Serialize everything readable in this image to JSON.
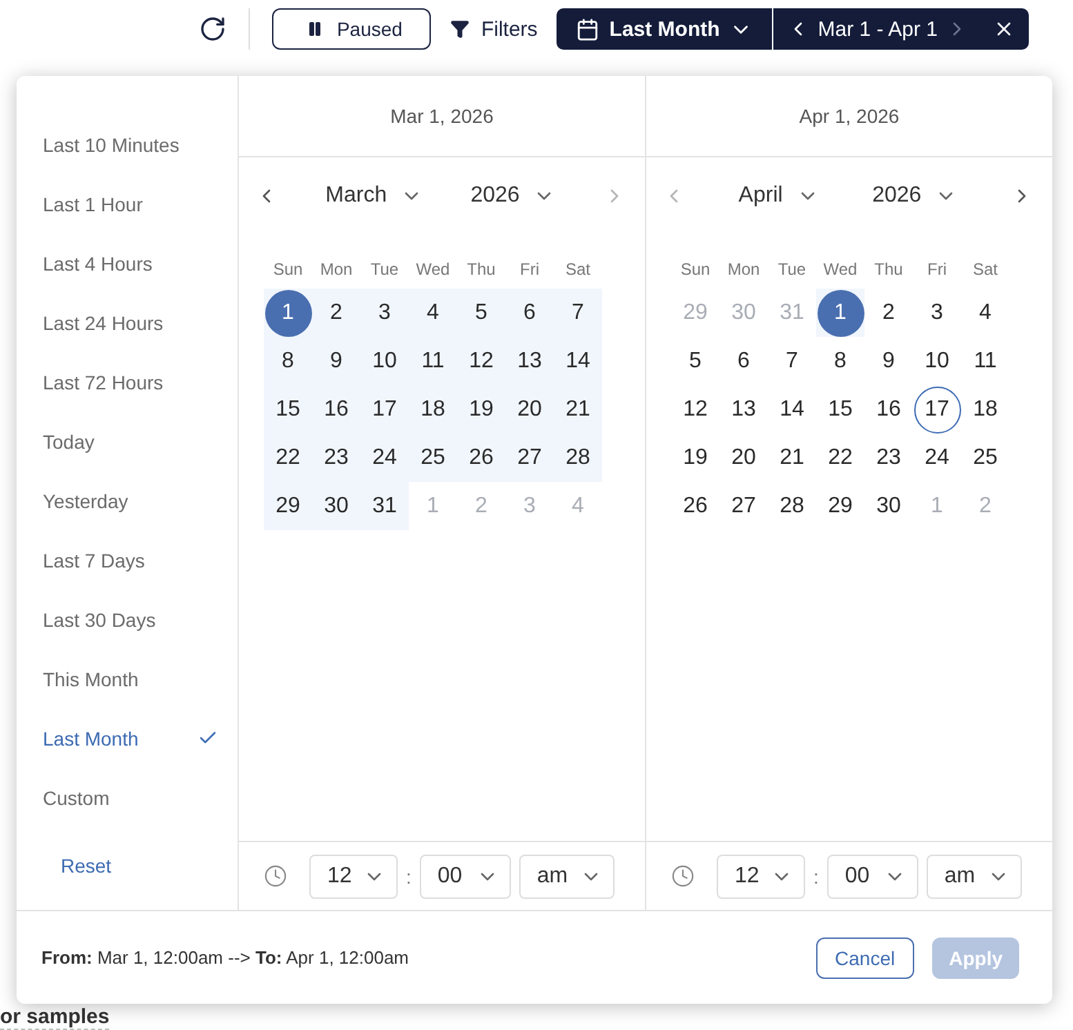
{
  "toolbar": {
    "pause_button": {
      "label": "Paused"
    },
    "filters_button": {
      "label": "Filters"
    },
    "range_button": {
      "label": "Last Month"
    },
    "range_nav": {
      "label": "Mar 1 - Apr 1",
      "prev_enabled": true,
      "next_enabled": false
    }
  },
  "background": {
    "heading": "or samples"
  },
  "presets": [
    {
      "label": "Last 10 Minutes",
      "selected": false
    },
    {
      "label": "Last 1 Hour",
      "selected": false
    },
    {
      "label": "Last 4 Hours",
      "selected": false
    },
    {
      "label": "Last 24 Hours",
      "selected": false
    },
    {
      "label": "Last 72 Hours",
      "selected": false
    },
    {
      "label": "Today",
      "selected": false
    },
    {
      "label": "Yesterday",
      "selected": false
    },
    {
      "label": "Last 7 Days",
      "selected": false
    },
    {
      "label": "Last 30 Days",
      "selected": false
    },
    {
      "label": "This Month",
      "selected": false
    },
    {
      "label": "Last Month",
      "selected": true
    },
    {
      "label": "Custom",
      "selected": false
    }
  ],
  "reset": "Reset",
  "calendars": [
    {
      "date_label": "Mar 1, 2026",
      "month": "March",
      "year": "2026",
      "prev_enabled": true,
      "next_enabled": false,
      "weekdays": [
        "Sun",
        "Mon",
        "Tue",
        "Wed",
        "Thu",
        "Fri",
        "Sat"
      ],
      "days": [
        {
          "label": "1",
          "outside": false,
          "in_range": true,
          "selected": true,
          "today": false
        },
        {
          "label": "2",
          "outside": false,
          "in_range": true,
          "selected": false,
          "today": false
        },
        {
          "label": "3",
          "outside": false,
          "in_range": true,
          "selected": false,
          "today": false
        },
        {
          "label": "4",
          "outside": false,
          "in_range": true,
          "selected": false,
          "today": false
        },
        {
          "label": "5",
          "outside": false,
          "in_range": true,
          "selected": false,
          "today": false
        },
        {
          "label": "6",
          "outside": false,
          "in_range": true,
          "selected": false,
          "today": false
        },
        {
          "label": "7",
          "outside": false,
          "in_range": true,
          "selected": false,
          "today": false
        },
        {
          "label": "8",
          "outside": false,
          "in_range": true,
          "selected": false,
          "today": false
        },
        {
          "label": "9",
          "outside": false,
          "in_range": true,
          "selected": false,
          "today": false
        },
        {
          "label": "10",
          "outside": false,
          "in_range": true,
          "selected": false,
          "today": false
        },
        {
          "label": "11",
          "outside": false,
          "in_range": true,
          "selected": false,
          "today": false
        },
        {
          "label": "12",
          "outside": false,
          "in_range": true,
          "selected": false,
          "today": false
        },
        {
          "label": "13",
          "outside": false,
          "in_range": true,
          "selected": false,
          "today": false
        },
        {
          "label": "14",
          "outside": false,
          "in_range": true,
          "selected": false,
          "today": false
        },
        {
          "label": "15",
          "outside": false,
          "in_range": true,
          "selected": false,
          "today": false
        },
        {
          "label": "16",
          "outside": false,
          "in_range": true,
          "selected": false,
          "today": false
        },
        {
          "label": "17",
          "outside": false,
          "in_range": true,
          "selected": false,
          "today": false
        },
        {
          "label": "18",
          "outside": false,
          "in_range": true,
          "selected": false,
          "today": false
        },
        {
          "label": "19",
          "outside": false,
          "in_range": true,
          "selected": false,
          "today": false
        },
        {
          "label": "20",
          "outside": false,
          "in_range": true,
          "selected": false,
          "today": false
        },
        {
          "label": "21",
          "outside": false,
          "in_range": true,
          "selected": false,
          "today": false
        },
        {
          "label": "22",
          "outside": false,
          "in_range": true,
          "selected": false,
          "today": false
        },
        {
          "label": "23",
          "outside": false,
          "in_range": true,
          "selected": false,
          "today": false
        },
        {
          "label": "24",
          "outside": false,
          "in_range": true,
          "selected": false,
          "today": false
        },
        {
          "label": "25",
          "outside": false,
          "in_range": true,
          "selected": false,
          "today": false
        },
        {
          "label": "26",
          "outside": false,
          "in_range": true,
          "selected": false,
          "today": false
        },
        {
          "label": "27",
          "outside": false,
          "in_range": true,
          "selected": false,
          "today": false
        },
        {
          "label": "28",
          "outside": false,
          "in_range": true,
          "selected": false,
          "today": false
        },
        {
          "label": "29",
          "outside": false,
          "in_range": true,
          "selected": false,
          "today": false
        },
        {
          "label": "30",
          "outside": false,
          "in_range": true,
          "selected": false,
          "today": false
        },
        {
          "label": "31",
          "outside": false,
          "in_range": true,
          "selected": false,
          "today": false
        },
        {
          "label": "1",
          "outside": true,
          "in_range": false,
          "selected": false,
          "today": false
        },
        {
          "label": "2",
          "outside": true,
          "in_range": false,
          "selected": false,
          "today": false
        },
        {
          "label": "3",
          "outside": true,
          "in_range": false,
          "selected": false,
          "today": false
        },
        {
          "label": "4",
          "outside": true,
          "in_range": false,
          "selected": false,
          "today": false
        }
      ],
      "time": {
        "hour": "12",
        "separator": ":",
        "minute": "00",
        "period": "am"
      }
    },
    {
      "date_label": "Apr 1, 2026",
      "month": "April",
      "year": "2026",
      "prev_enabled": false,
      "next_enabled": true,
      "weekdays": [
        "Sun",
        "Mon",
        "Tue",
        "Wed",
        "Thu",
        "Fri",
        "Sat"
      ],
      "days": [
        {
          "label": "29",
          "outside": true,
          "in_range": false,
          "selected": false,
          "today": false
        },
        {
          "label": "30",
          "outside": true,
          "in_range": false,
          "selected": false,
          "today": false
        },
        {
          "label": "31",
          "outside": true,
          "in_range": false,
          "selected": false,
          "today": false
        },
        {
          "label": "1",
          "outside": false,
          "in_range": true,
          "selected": true,
          "today": false
        },
        {
          "label": "2",
          "outside": false,
          "in_range": false,
          "selected": false,
          "today": false
        },
        {
          "label": "3",
          "outside": false,
          "in_range": false,
          "selected": false,
          "today": false
        },
        {
          "label": "4",
          "outside": false,
          "in_range": false,
          "selected": false,
          "today": false
        },
        {
          "label": "5",
          "outside": false,
          "in_range": false,
          "selected": false,
          "today": false
        },
        {
          "label": "6",
          "outside": false,
          "in_range": false,
          "selected": false,
          "today": false
        },
        {
          "label": "7",
          "outside": false,
          "in_range": false,
          "selected": false,
          "today": false
        },
        {
          "label": "8",
          "outside": false,
          "in_range": false,
          "selected": false,
          "today": false
        },
        {
          "label": "9",
          "outside": false,
          "in_range": false,
          "selected": false,
          "today": false
        },
        {
          "label": "10",
          "outside": false,
          "in_range": false,
          "selected": false,
          "today": false
        },
        {
          "label": "11",
          "outside": false,
          "in_range": false,
          "selected": false,
          "today": false
        },
        {
          "label": "12",
          "outside": false,
          "in_range": false,
          "selected": false,
          "today": false
        },
        {
          "label": "13",
          "outside": false,
          "in_range": false,
          "selected": false,
          "today": false
        },
        {
          "label": "14",
          "outside": false,
          "in_range": false,
          "selected": false,
          "today": false
        },
        {
          "label": "15",
          "outside": false,
          "in_range": false,
          "selected": false,
          "today": false
        },
        {
          "label": "16",
          "outside": false,
          "in_range": false,
          "selected": false,
          "today": false
        },
        {
          "label": "17",
          "outside": false,
          "in_range": false,
          "selected": false,
          "today": true
        },
        {
          "label": "18",
          "outside": false,
          "in_range": false,
          "selected": false,
          "today": false
        },
        {
          "label": "19",
          "outside": false,
          "in_range": false,
          "selected": false,
          "today": false
        },
        {
          "label": "20",
          "outside": false,
          "in_range": false,
          "selected": false,
          "today": false
        },
        {
          "label": "21",
          "outside": false,
          "in_range": false,
          "selected": false,
          "today": false
        },
        {
          "label": "22",
          "outside": false,
          "in_range": false,
          "selected": false,
          "today": false
        },
        {
          "label": "23",
          "outside": false,
          "in_range": false,
          "selected": false,
          "today": false
        },
        {
          "label": "24",
          "outside": false,
          "in_range": false,
          "selected": false,
          "today": false
        },
        {
          "label": "25",
          "outside": false,
          "in_range": false,
          "selected": false,
          "today": false
        },
        {
          "label": "26",
          "outside": false,
          "in_range": false,
          "selected": false,
          "today": false
        },
        {
          "label": "27",
          "outside": false,
          "in_range": false,
          "selected": false,
          "today": false
        },
        {
          "label": "28",
          "outside": false,
          "in_range": false,
          "selected": false,
          "today": false
        },
        {
          "label": "29",
          "outside": false,
          "in_range": false,
          "selected": false,
          "today": false
        },
        {
          "label": "30",
          "outside": false,
          "in_range": false,
          "selected": false,
          "today": false
        },
        {
          "label": "1",
          "outside": true,
          "in_range": false,
          "selected": false,
          "today": false
        },
        {
          "label": "2",
          "outside": true,
          "in_range": false,
          "selected": false,
          "today": false
        }
      ],
      "time": {
        "hour": "12",
        "separator": ":",
        "minute": "00",
        "period": "am"
      }
    }
  ],
  "footer": {
    "summary": "**From:** Mar 1, 12:00am --> **To:** Apr 1, 12:00am",
    "cancel": {
      "label": "Cancel",
      "disabled": false
    },
    "apply": {
      "label": "Apply",
      "disabled": true
    }
  }
}
